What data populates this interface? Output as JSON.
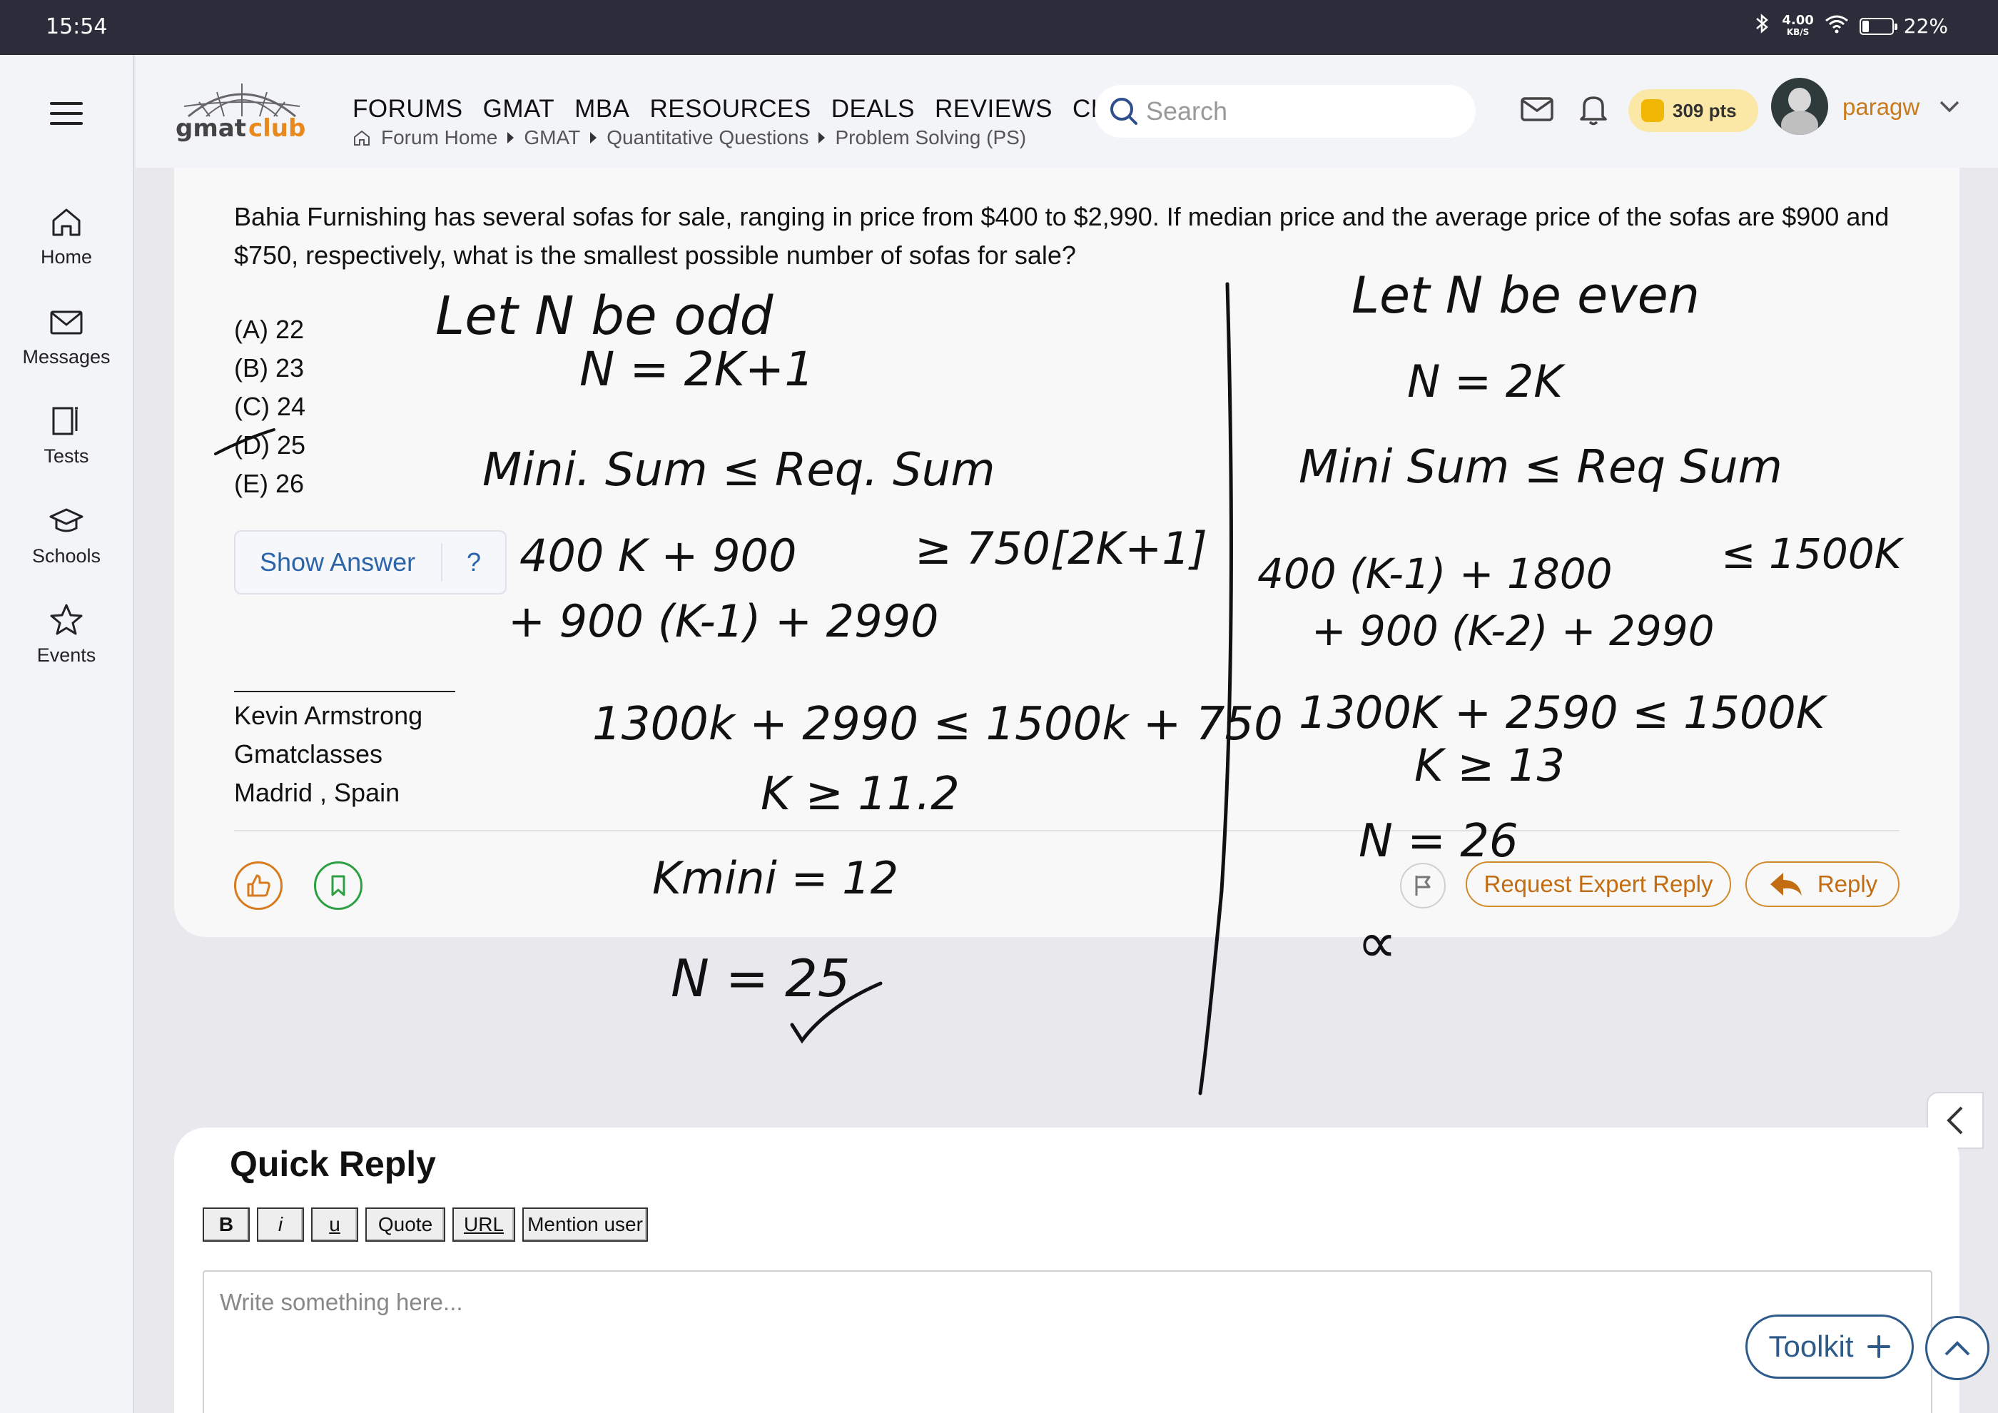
{
  "status_bar": {
    "time": "15:54",
    "speed_value": "4.00",
    "speed_unit": "KB/S",
    "battery": "22%",
    "battery_level": 0.22
  },
  "sidebar": {
    "items": [
      {
        "label": "Home",
        "icon": "home-icon"
      },
      {
        "label": "Messages",
        "icon": "envelope-icon"
      },
      {
        "label": "Tests",
        "icon": "notepad-icon"
      },
      {
        "label": "Schools",
        "icon": "graduation-cap-icon"
      },
      {
        "label": "Events",
        "icon": "star-icon"
      }
    ]
  },
  "header": {
    "logo_text_a": "gmat",
    "logo_text_b": "club",
    "nav": [
      "FORUMS",
      "GMAT",
      "MBA",
      "RESOURCES",
      "DEALS",
      "REVIEWS",
      "CHAT"
    ],
    "breadcrumb": [
      "Forum Home",
      "GMAT",
      "Quantitative Questions",
      "Problem Solving (PS)"
    ],
    "search_placeholder": "Search",
    "points": "309 pts",
    "username": "paragw"
  },
  "post": {
    "question": "Bahia Furnishing has several sofas for sale, ranging in price from $400 to $2,990. If median price and the average price of the sofas are $900 and $750, respectively, what is the smallest possible number of sofas for sale?",
    "options": [
      "(A) 22",
      "(B) 23",
      "(C) 24",
      "(D) 25",
      "(E) 26"
    ],
    "show_answer": "Show Answer",
    "help": "?",
    "signature": [
      "Kevin Armstrong",
      "Gmatclasses",
      "Madrid , Spain"
    ],
    "request_expert_reply": "Request Expert Reply",
    "reply": "Reply"
  },
  "handwriting": {
    "left": [
      "Let N be odd",
      "N = 2K+1",
      "Mini. Sum ≤ Req. Sum",
      "400 K + 900",
      "≥ 750[2K+1]",
      "+ 900 (K-1) + 2990",
      "1300k + 2990 ≤ 1500k + 750",
      "K ≥ 11.2",
      "Kmini = 12",
      "N = 25"
    ],
    "right": [
      "Let N be even",
      "N = 2K",
      "Mini Sum ≤ Req Sum",
      "400 (K-1) + 1800",
      "≤ 1500K",
      "+ 900 (K-2) + 2990",
      "1300K + 2590 ≤ 1500K",
      "K ≥ 13",
      "N = 26",
      "∝"
    ]
  },
  "quick_reply": {
    "title": "Quick Reply",
    "toolbar": [
      "B",
      "i",
      "u",
      "Quote",
      "URL",
      "Mention user"
    ],
    "placeholder": "Write something here..."
  },
  "toolkit": "Toolkit",
  "colors": {
    "accent_orange": "#c97a1a",
    "link_blue": "#2b64a8",
    "toolkit_blue": "#2e5a8a",
    "status_bar": "#2b2e3a"
  }
}
